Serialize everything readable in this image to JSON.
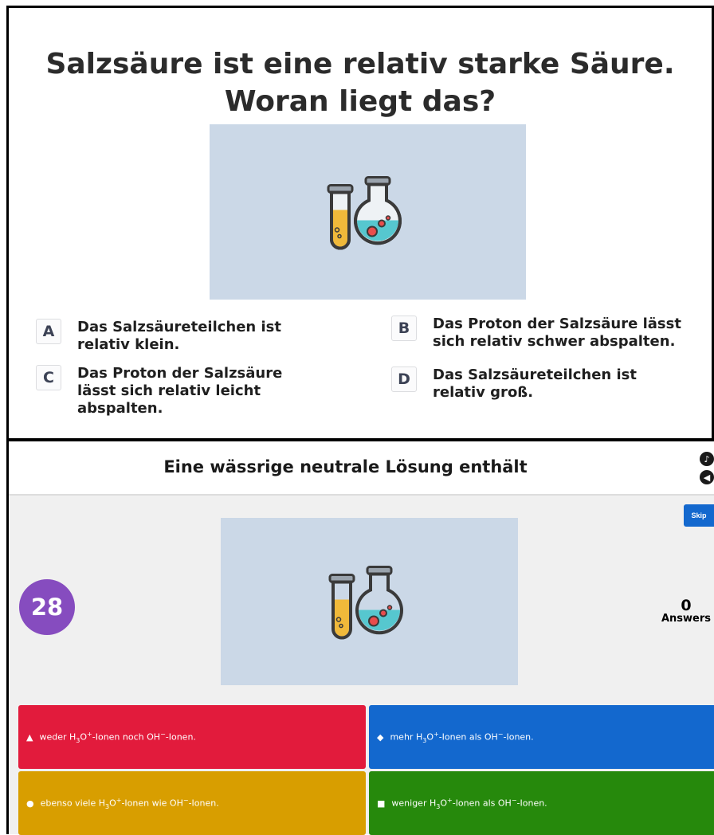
{
  "quiz1": {
    "question": "Salzsäure ist eine relativ starke Säure. Woran liegt das?",
    "image_icon": "chemistry-flasks-icon",
    "options": [
      {
        "letter": "A",
        "text": "Das Salzsäureteilchen ist relativ klein."
      },
      {
        "letter": "B",
        "text": "Das Proton der Salzsäure lässt sich relativ schwer abspalten."
      },
      {
        "letter": "C",
        "text": "Das Proton der Salzsäure lässt sich relativ leicht abspalten."
      },
      {
        "letter": "D",
        "text": "Das Salzsäureteilchen ist relativ groß."
      }
    ]
  },
  "quiz2": {
    "question": "Eine wässrige neutrale Lösung enthält",
    "skip_label": "Skip",
    "timer": "28",
    "answers_count": "0",
    "answers_label": "Answers",
    "image_icon": "chemistry-flasks-icon",
    "tiles": [
      {
        "shape": "triangle-icon",
        "pre": "weder H",
        "sub": "3",
        "mid": "O",
        "sup": "+",
        "post": "-Ionen noch OH",
        "sup2": "−",
        "end": "-Ionen.",
        "color": "#e21b3c"
      },
      {
        "shape": "diamond-icon",
        "pre": "mehr H",
        "sub": "3",
        "mid": "O",
        "sup": "+",
        "post": "-Ionen als OH",
        "sup2": "−",
        "end": "-Ionen.",
        "color": "#1368ce"
      },
      {
        "shape": "circle-icon",
        "pre": "ebenso viele H",
        "sub": "3",
        "mid": "O",
        "sup": "+",
        "post": "-Ionen wie OH",
        "sup2": "−",
        "end": "-Ionen.",
        "color": "#d89e00"
      },
      {
        "shape": "square-icon",
        "pre": "weniger H",
        "sub": "3",
        "mid": "O",
        "sup": "+",
        "post": "-Ionen als OH",
        "sup2": "−",
        "end": "-Ionen.",
        "color": "#26890c"
      }
    ]
  }
}
